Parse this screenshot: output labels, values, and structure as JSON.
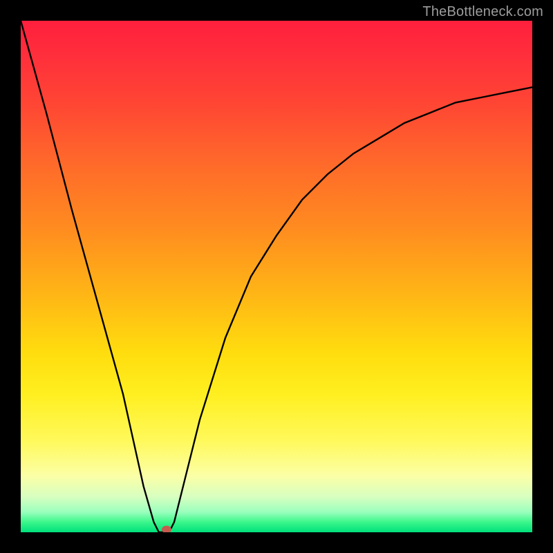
{
  "watermark": "TheBottleneck.com",
  "chart_data": {
    "type": "line",
    "title": "TheBottleneck.com",
    "xlabel": "",
    "ylabel": "",
    "xlim": [
      0,
      100
    ],
    "ylim": [
      0,
      100
    ],
    "x": [
      0,
      5,
      10,
      15,
      20,
      24,
      26,
      27,
      28,
      29,
      30,
      32,
      35,
      40,
      45,
      50,
      55,
      60,
      65,
      70,
      75,
      80,
      85,
      90,
      95,
      100
    ],
    "values": [
      100,
      82,
      63,
      45,
      27,
      9,
      2,
      0,
      0,
      0,
      2,
      10,
      22,
      38,
      50,
      58,
      65,
      70,
      74,
      77,
      80,
      82,
      84,
      85,
      86,
      87
    ],
    "marker": {
      "x": 28.5,
      "y": 0.5
    },
    "background_gradient": {
      "top": "#ff1f3d",
      "mid": "#ffdd0e",
      "bottom": "#00e07c"
    }
  }
}
